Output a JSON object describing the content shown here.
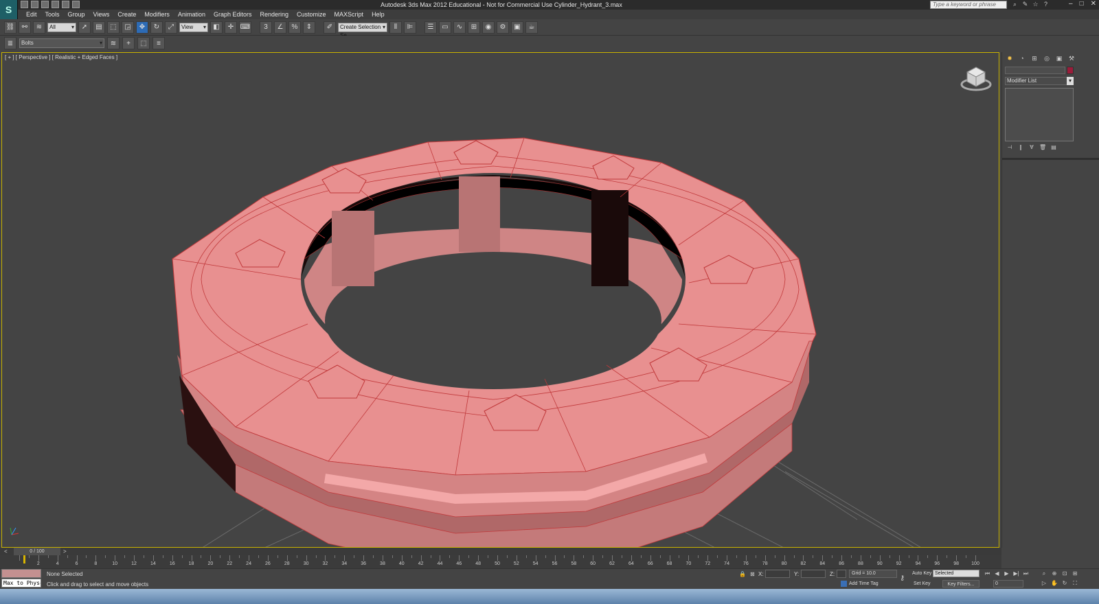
{
  "window": {
    "title": "Autodesk 3ds Max  2012   Educational - Not for Commercial Use    Cylinder_Hydrant_3.max",
    "search_placeholder": "Type a keyword or phrase"
  },
  "menu": {
    "items": [
      "Edit",
      "Tools",
      "Group",
      "Views",
      "Create",
      "Modifiers",
      "Animation",
      "Graph Editors",
      "Rendering",
      "Customize",
      "MAXScript",
      "Help"
    ]
  },
  "toolbar": {
    "selection_filter": "All",
    "reference_coord": "View",
    "snap_label": "3",
    "named_selection_placeholder": "Create Selection Se"
  },
  "layer_toolbar": {
    "current_layer": "Bolts"
  },
  "viewport": {
    "label": "[ + ] [ Perspective ] [ Realistic + Edged Faces ]"
  },
  "command_panel": {
    "modifier_list": "Modifier List",
    "object_color": "#9b1c3a"
  },
  "time_slider": {
    "label": "0 / 100"
  },
  "trackbar": {
    "ticks": [
      "2",
      "4",
      "6",
      "8",
      "10",
      "12",
      "14",
      "16",
      "18",
      "20",
      "22",
      "24",
      "26",
      "28",
      "30",
      "32",
      "34",
      "36",
      "38",
      "40",
      "42",
      "44",
      "46",
      "48",
      "50",
      "52",
      "54",
      "56",
      "58",
      "60",
      "62",
      "64",
      "66",
      "68",
      "70",
      "72",
      "74",
      "76",
      "78",
      "80",
      "82",
      "84",
      "86",
      "88",
      "90",
      "92",
      "94",
      "96",
      "98",
      "100"
    ]
  },
  "status": {
    "maxscript_input": "Max to Physc.",
    "selection": "None Selected",
    "prompt": "Click and drag to select and move objects",
    "x_label": "X:",
    "y_label": "Y:",
    "z_label": "Z:",
    "grid": "Grid = 10.0",
    "time_tag": "Add Time Tag",
    "auto_key": "Auto Key",
    "set_key": "Set Key",
    "key_mode": "Selected",
    "key_filters": "Key Filters...",
    "frame": "0"
  },
  "colors": {
    "mesh_fill": "#e89090",
    "mesh_edges": "#c0383a",
    "viewport_border": "#c9b300",
    "active_tool": "#2d6bb5"
  }
}
